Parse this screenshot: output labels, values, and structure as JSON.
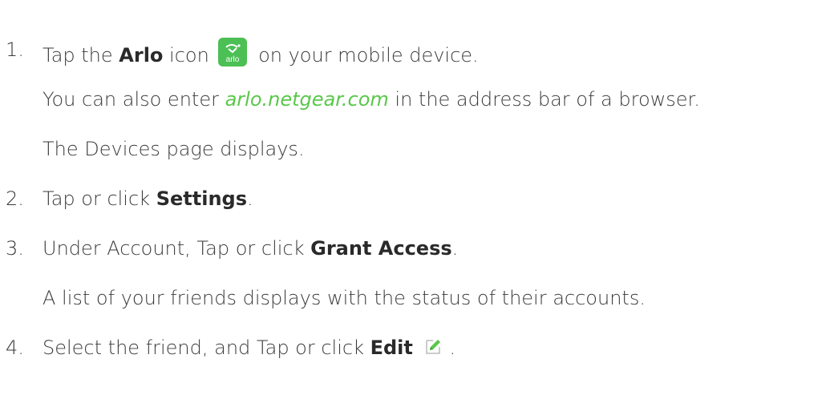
{
  "steps": [
    {
      "number": "1.",
      "text_before": "Tap the ",
      "bold": "Arlo",
      "text_middle": " icon",
      "icon_label": "arlo",
      "text_after": " on your mobile device.",
      "sub_1_before": "You can also enter ",
      "sub_1_link": "arlo.netgear.com",
      "sub_1_after": " in the address bar of a browser.",
      "sub_2": "The Devices page displays."
    },
    {
      "number": "2.",
      "text_before": "Tap or click ",
      "bold": "Settings",
      "text_after": "."
    },
    {
      "number": "3.",
      "text_before": "Under Account, Tap or click ",
      "bold": "Grant Access",
      "text_after": ".",
      "sub_1": "A list of your friends displays with the status of their accounts."
    },
    {
      "number": "4.",
      "text_before": "Select the friend, and Tap or click ",
      "bold": "Edit",
      "text_after": " ."
    }
  ],
  "colors": {
    "text": "#3a3a3a",
    "link": "#59c84a",
    "arlo_green": "#4cbf55",
    "edit_icon": "#59c84a"
  },
  "icons": {
    "arlo": "arlo-app-icon",
    "edit": "edit-pencil-icon"
  }
}
